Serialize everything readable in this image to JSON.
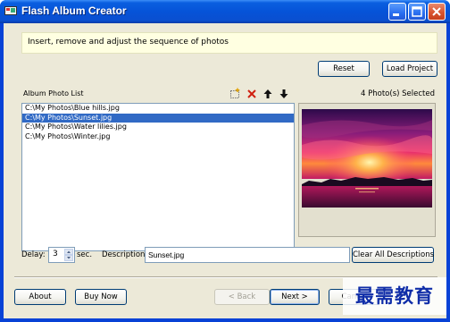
{
  "window": {
    "title": "Flash Album Creator"
  },
  "banner": {
    "text": "Insert, remove and adjust the sequence of photos"
  },
  "buttons": {
    "reset": "Reset",
    "load_project": "Load Project",
    "clear_all_descriptions": "Clear All Descriptions",
    "about": "About",
    "buy_now": "Buy Now",
    "back": "< Back",
    "next": "Next >",
    "cancel": "Cancel"
  },
  "photo_list": {
    "title": "Album Photo List",
    "toolbar": [
      "add-icon",
      "remove-icon",
      "move-up-icon",
      "move-down-icon"
    ],
    "items": [
      {
        "path": "C:\\My Photos\\Blue hills.jpg",
        "selected": false
      },
      {
        "path": "C:\\My Photos\\Sunset.jpg",
        "selected": true
      },
      {
        "path": "C:\\My Photos\\Water lilies.jpg",
        "selected": false
      },
      {
        "path": "C:\\My Photos\\Winter.jpg",
        "selected": false
      }
    ]
  },
  "selection": {
    "count_text": "4 Photo(s) Selected"
  },
  "preview": {
    "image": "sunset-photo"
  },
  "settings": {
    "delay_label": "Delay:",
    "delay_value": "3",
    "delay_unit": "sec.",
    "description_label": "Description:",
    "description_value": "Sunset.jpg"
  },
  "watermark": {
    "text": "最需教育"
  },
  "colors": {
    "selection": "#316ac5",
    "banner": "#ffffe1",
    "titlebar": "#0653d8",
    "dialog": "#ece9d8"
  }
}
